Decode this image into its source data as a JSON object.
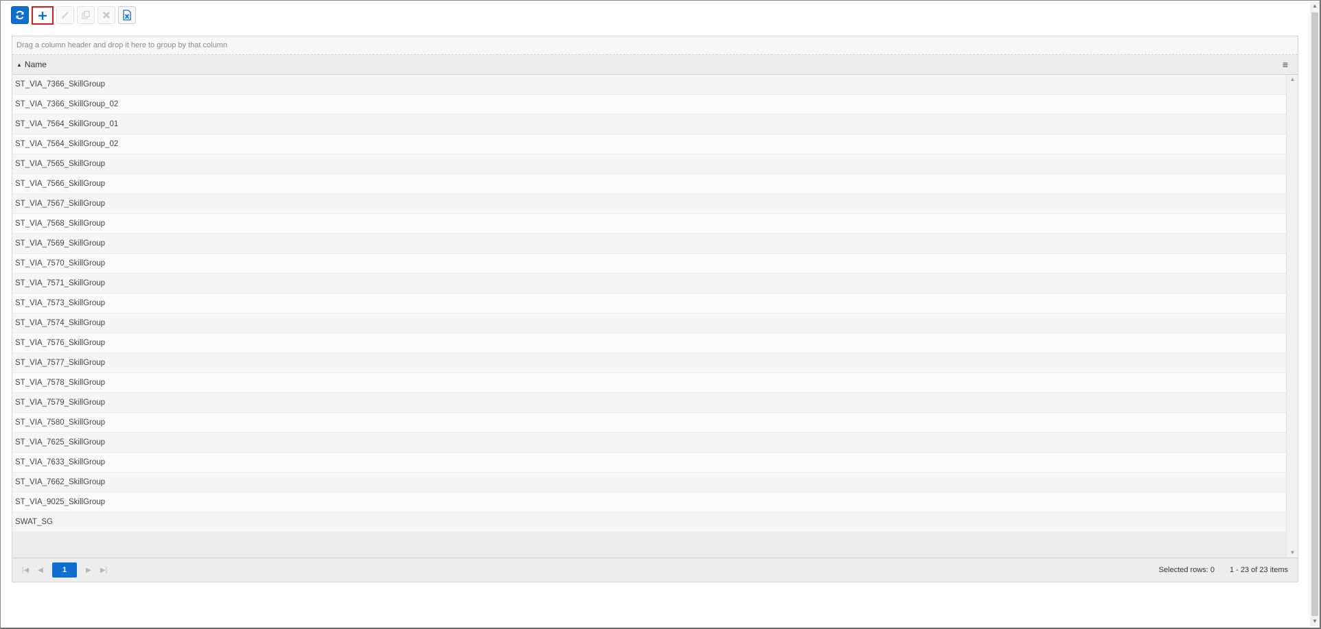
{
  "toolbar": {
    "buttons": [
      {
        "name": "refresh-button",
        "icon": "refresh-icon",
        "state": "primary"
      },
      {
        "name": "add-button",
        "icon": "plus-icon",
        "state": "focused"
      },
      {
        "name": "edit-button",
        "icon": "pencil-icon",
        "state": "disabled"
      },
      {
        "name": "copy-button",
        "icon": "copy-icon",
        "state": "disabled"
      },
      {
        "name": "delete-button",
        "icon": "close-icon",
        "state": "disabled"
      },
      {
        "name": "export-excel-button",
        "icon": "excel-icon",
        "state": "enabled"
      }
    ]
  },
  "grid": {
    "group_hint": "Drag a column header and drop it here to group by that column",
    "columns": [
      {
        "title": "Name",
        "sort": "ascending"
      }
    ],
    "rows": [
      "ST_VIA_7366_SkillGroup",
      "ST_VIA_7366_SkillGroup_02",
      "ST_VIA_7564_SkillGroup_01",
      "ST_VIA_7564_SkillGroup_02",
      "ST_VIA_7565_SkillGroup",
      "ST_VIA_7566_SkillGroup",
      "ST_VIA_7567_SkillGroup",
      "ST_VIA_7568_SkillGroup",
      "ST_VIA_7569_SkillGroup",
      "ST_VIA_7570_SkillGroup",
      "ST_VIA_7571_SkillGroup",
      "ST_VIA_7573_SkillGroup",
      "ST_VIA_7574_SkillGroup",
      "ST_VIA_7576_SkillGroup",
      "ST_VIA_7577_SkillGroup",
      "ST_VIA_7578_SkillGroup",
      "ST_VIA_7579_SkillGroup",
      "ST_VIA_7580_SkillGroup",
      "ST_VIA_7625_SkillGroup",
      "ST_VIA_7633_SkillGroup",
      "ST_VIA_7662_SkillGroup",
      "ST_VIA_9025_SkillGroup",
      "SWAT_SG"
    ]
  },
  "pager": {
    "current_page": "1",
    "selected_rows": "Selected rows: 0",
    "items_info": "1 - 23 of 23 items"
  },
  "colors": {
    "accent": "#0e6fd0",
    "focus_outline": "#e3171d"
  }
}
